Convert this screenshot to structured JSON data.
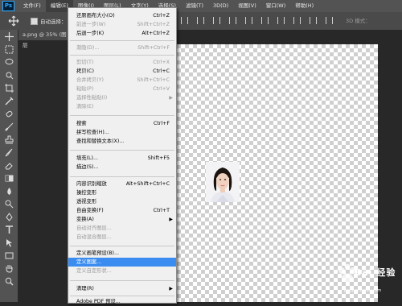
{
  "menubar": {
    "logo": "Ps",
    "items": [
      "文件(F)",
      "编辑(E)",
      "图像(I)",
      "图层(L)",
      "文字(Y)",
      "选择(S)",
      "滤镜(T)",
      "3D(D)",
      "视图(V)",
      "窗口(W)",
      "帮助(H)"
    ]
  },
  "options": {
    "auto_select_label": "自动选择：",
    "mode_label": "3D 模式："
  },
  "document": {
    "tab_title": "a.png @ 35% (图层"
  },
  "edit_menu": {
    "items": [
      {
        "label": "还原画布大小(O)",
        "shortcut": "Ctrl+Z"
      },
      {
        "label": "前进一步(W)",
        "shortcut": "Shift+Ctrl+Z"
      },
      {
        "label": "后退一步(K)",
        "shortcut": "Alt+Ctrl+Z"
      },
      {
        "label": "渐隐(D)...",
        "shortcut": "Shift+Ctrl+F"
      },
      {
        "label": "剪切(T)",
        "shortcut": "Ctrl+X"
      },
      {
        "label": "拷贝(C)",
        "shortcut": "Ctrl+C"
      },
      {
        "label": "合并拷贝(Y)",
        "shortcut": "Shift+Ctrl+C"
      },
      {
        "label": "粘贴(P)",
        "shortcut": "Ctrl+V"
      },
      {
        "label": "选择性粘贴(I)",
        "shortcut": ""
      },
      {
        "label": "清除(E)",
        "shortcut": ""
      },
      {
        "label": "搜索",
        "shortcut": "Ctrl+F"
      },
      {
        "label": "拼写检查(H)...",
        "shortcut": ""
      },
      {
        "label": "查找和替换文本(X)...",
        "shortcut": ""
      },
      {
        "label": "填充(L)...",
        "shortcut": "Shift+F5"
      },
      {
        "label": "描边(S)...",
        "shortcut": ""
      },
      {
        "label": "内容识别缩放",
        "shortcut": "Alt+Shift+Ctrl+C"
      },
      {
        "label": "操控变形",
        "shortcut": ""
      },
      {
        "label": "透视变形",
        "shortcut": ""
      },
      {
        "label": "自由变换(F)",
        "shortcut": "Ctrl+T"
      },
      {
        "label": "变换(A)",
        "shortcut": ""
      },
      {
        "label": "自动对齐图层...",
        "shortcut": ""
      },
      {
        "label": "自动混合图层...",
        "shortcut": ""
      },
      {
        "label": "定义画笔预设(B)...",
        "shortcut": ""
      },
      {
        "label": "定义图案...",
        "shortcut": ""
      },
      {
        "label": "定义自定形状...",
        "shortcut": ""
      },
      {
        "label": "清理(R)",
        "shortcut": ""
      },
      {
        "label": "Adobe PDF 预设...",
        "shortcut": ""
      }
    ]
  },
  "watermark": {
    "text": "Bai 经验",
    "sub": "jingyan.baidu.com"
  }
}
